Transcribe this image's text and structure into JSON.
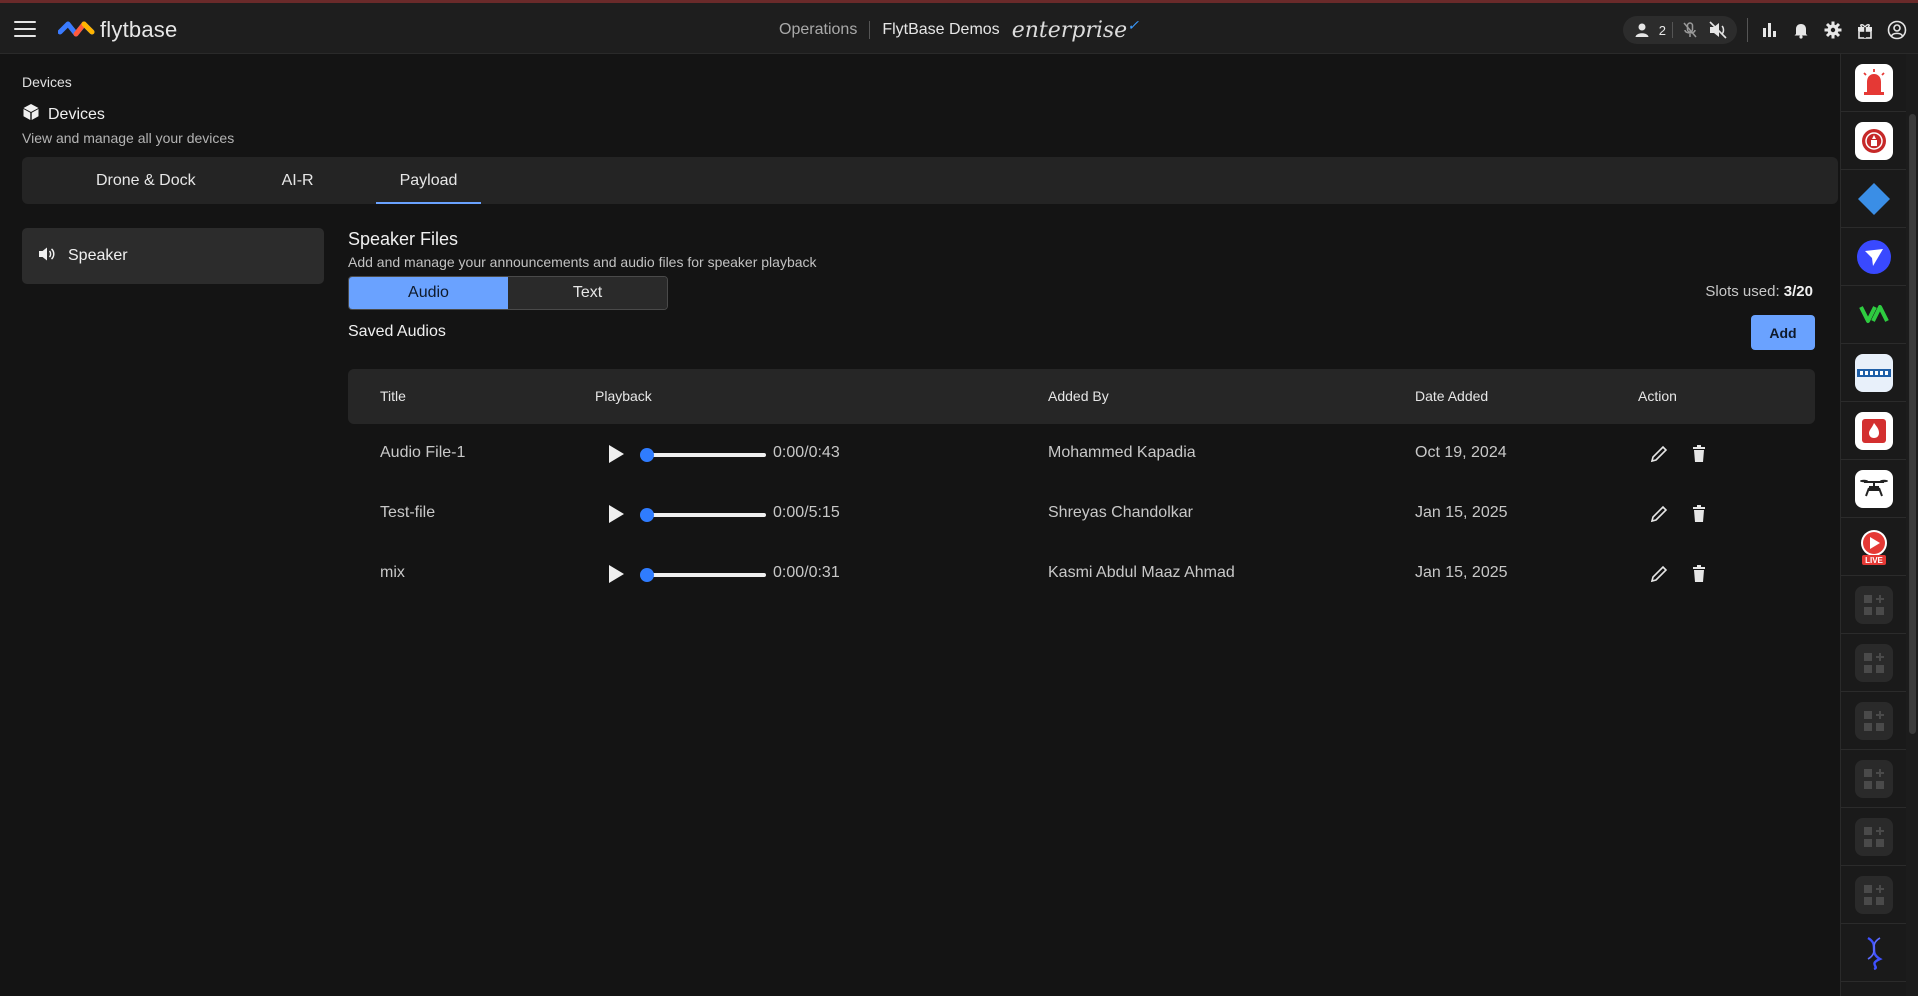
{
  "topbar": {
    "logo_text": "flytbase",
    "nav_operations": "Operations",
    "org_name": "FlytBase Demos",
    "plan": "enterprise",
    "user_count": "2"
  },
  "breadcrumb": "Devices",
  "page": {
    "title": "Devices",
    "subtitle": "View and manage all your devices"
  },
  "tabs": [
    {
      "label": "Drone & Dock"
    },
    {
      "label": "AI-R"
    },
    {
      "label": "Payload"
    }
  ],
  "sidebar": {
    "items": [
      {
        "label": "Speaker",
        "icon": "speaker-icon"
      }
    ]
  },
  "speaker_files": {
    "title": "Speaker Files",
    "subtitle": "Add and manage your announcements and audio files for speaker playback",
    "segments": [
      "Audio",
      "Text"
    ],
    "slots_label": "Slots used:",
    "slots_value": "3/20",
    "saved_label": "Saved Audios",
    "add_label": "Add"
  },
  "table": {
    "headers": [
      "Title",
      "Playback",
      "Added By",
      "Date Added",
      "Action"
    ],
    "rows": [
      {
        "title": "Audio File-1",
        "time": "0:00/0:43",
        "added_by": "Mohammed Kapadia",
        "date": "Oct 19, 2024",
        "progress": 0
      },
      {
        "title": "Test-file",
        "time": "0:00/5:15",
        "added_by": "Shreyas Chandolkar",
        "date": "Jan 15, 2025",
        "progress": 0
      },
      {
        "title": "mix",
        "time": "0:00/0:31",
        "added_by": "Kasmi Abdul Maaz Ahmad",
        "date": "Jan 15, 2025",
        "progress": 0
      }
    ]
  },
  "colors": {
    "accent": "#6aa2ff",
    "slider": "#2f7cff",
    "background": "#141414"
  },
  "rail_icons": [
    "alarm-icon",
    "badge-icon",
    "diamond-icon",
    "navigation-icon",
    "va-logo-icon",
    "genetec-logo-icon",
    "fire-alert-icon",
    "drone-icon",
    "live-icon",
    "add-widget-icon",
    "add-widget-icon",
    "add-widget-icon",
    "add-widget-icon",
    "add-widget-icon",
    "add-widget-icon",
    "dna-icon"
  ]
}
